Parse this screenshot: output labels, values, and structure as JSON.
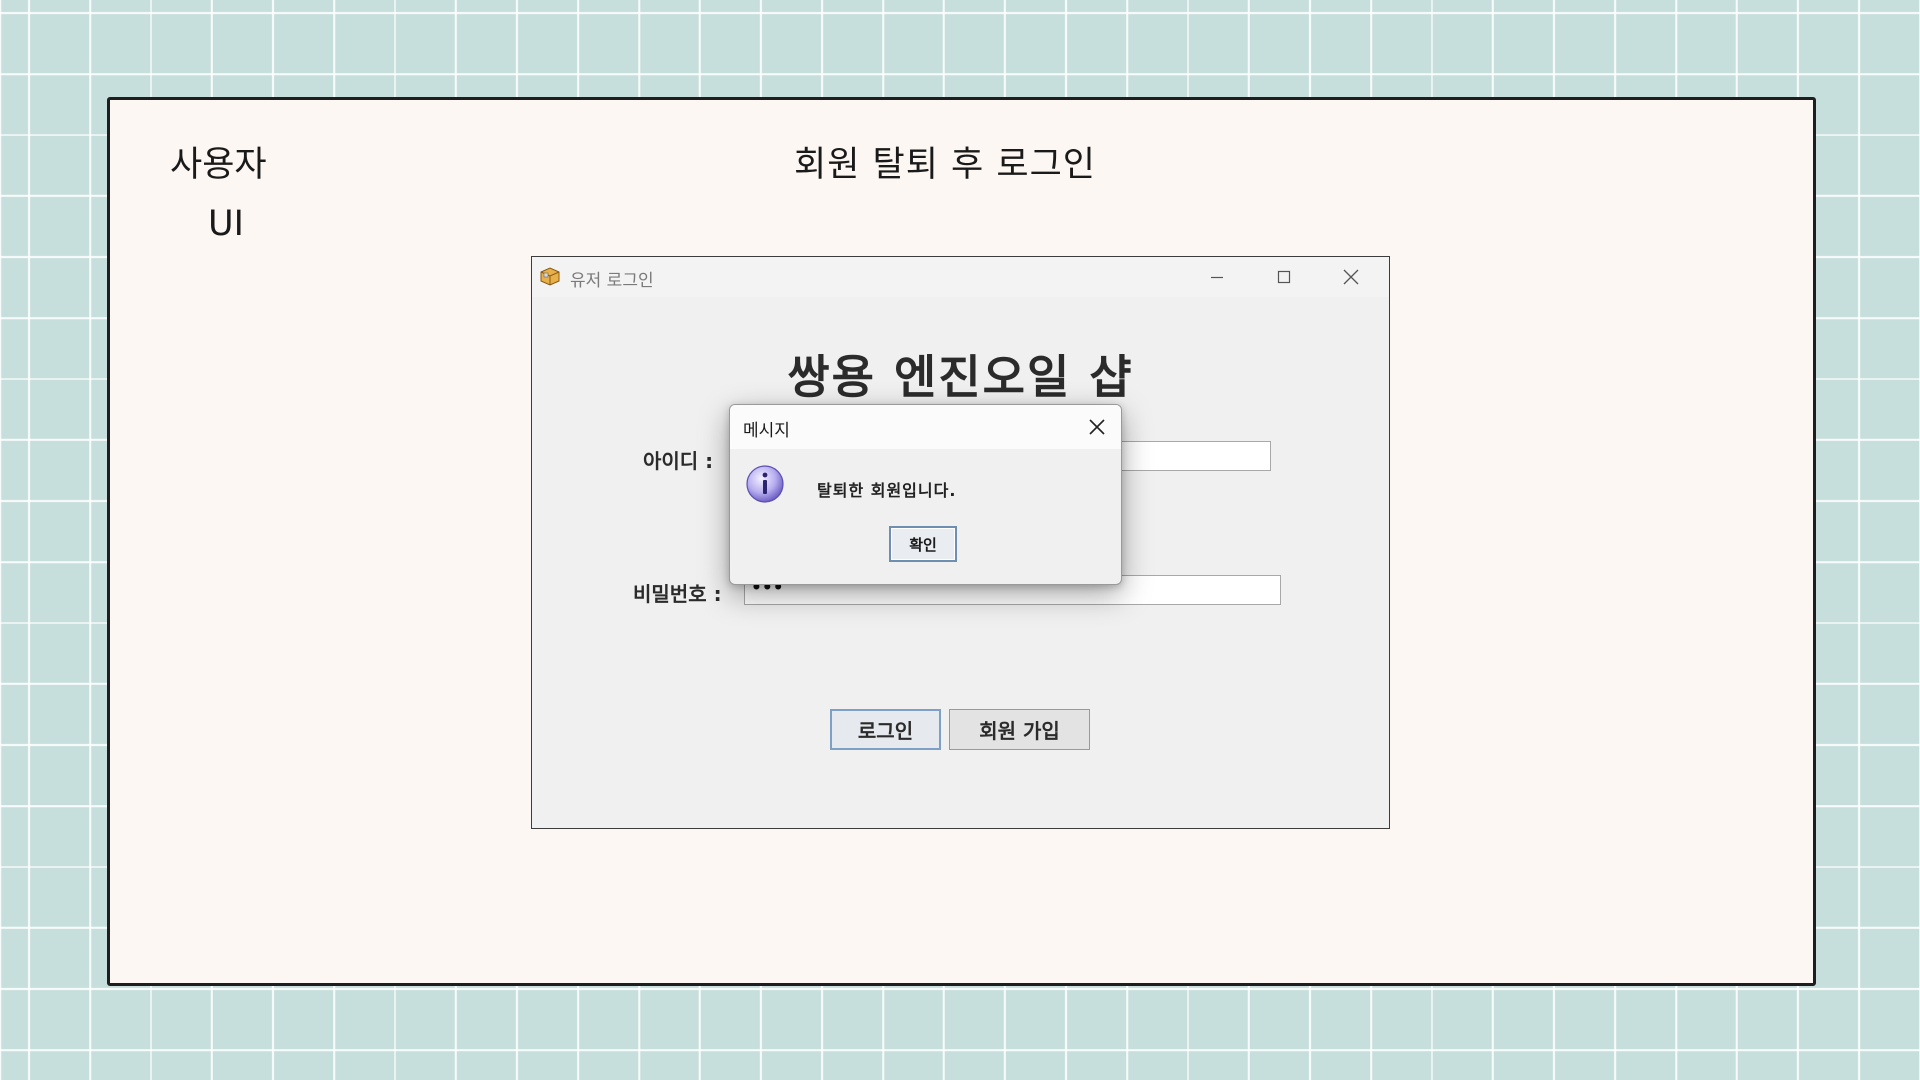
{
  "slide": {
    "label_line1": "사용자",
    "label_line2": "UI",
    "title": "회원 탈퇴 후 로그인"
  },
  "window": {
    "title": "유저 로그인",
    "app_icon": "package-icon",
    "controls": {
      "minimize": "minimize-icon",
      "maximize": "maximize-icon",
      "close": "close-icon"
    }
  },
  "form": {
    "shop_title": "쌍용 엔진오일 샵",
    "id_label": "아이디 :",
    "id_value": "",
    "password_label": "비밀번호 :",
    "password_value": "•••",
    "login_button": "로그인",
    "signup_button": "회원 가입"
  },
  "dialog": {
    "title": "메시지",
    "icon": "info-icon",
    "message": "탈퇴한 회원입니다.",
    "ok_button": "확인"
  },
  "colors": {
    "background": "#c7dfdc",
    "slide": "#fcf7f2",
    "window": "#f0f0f0",
    "focus_border": "#7ea0c4"
  }
}
